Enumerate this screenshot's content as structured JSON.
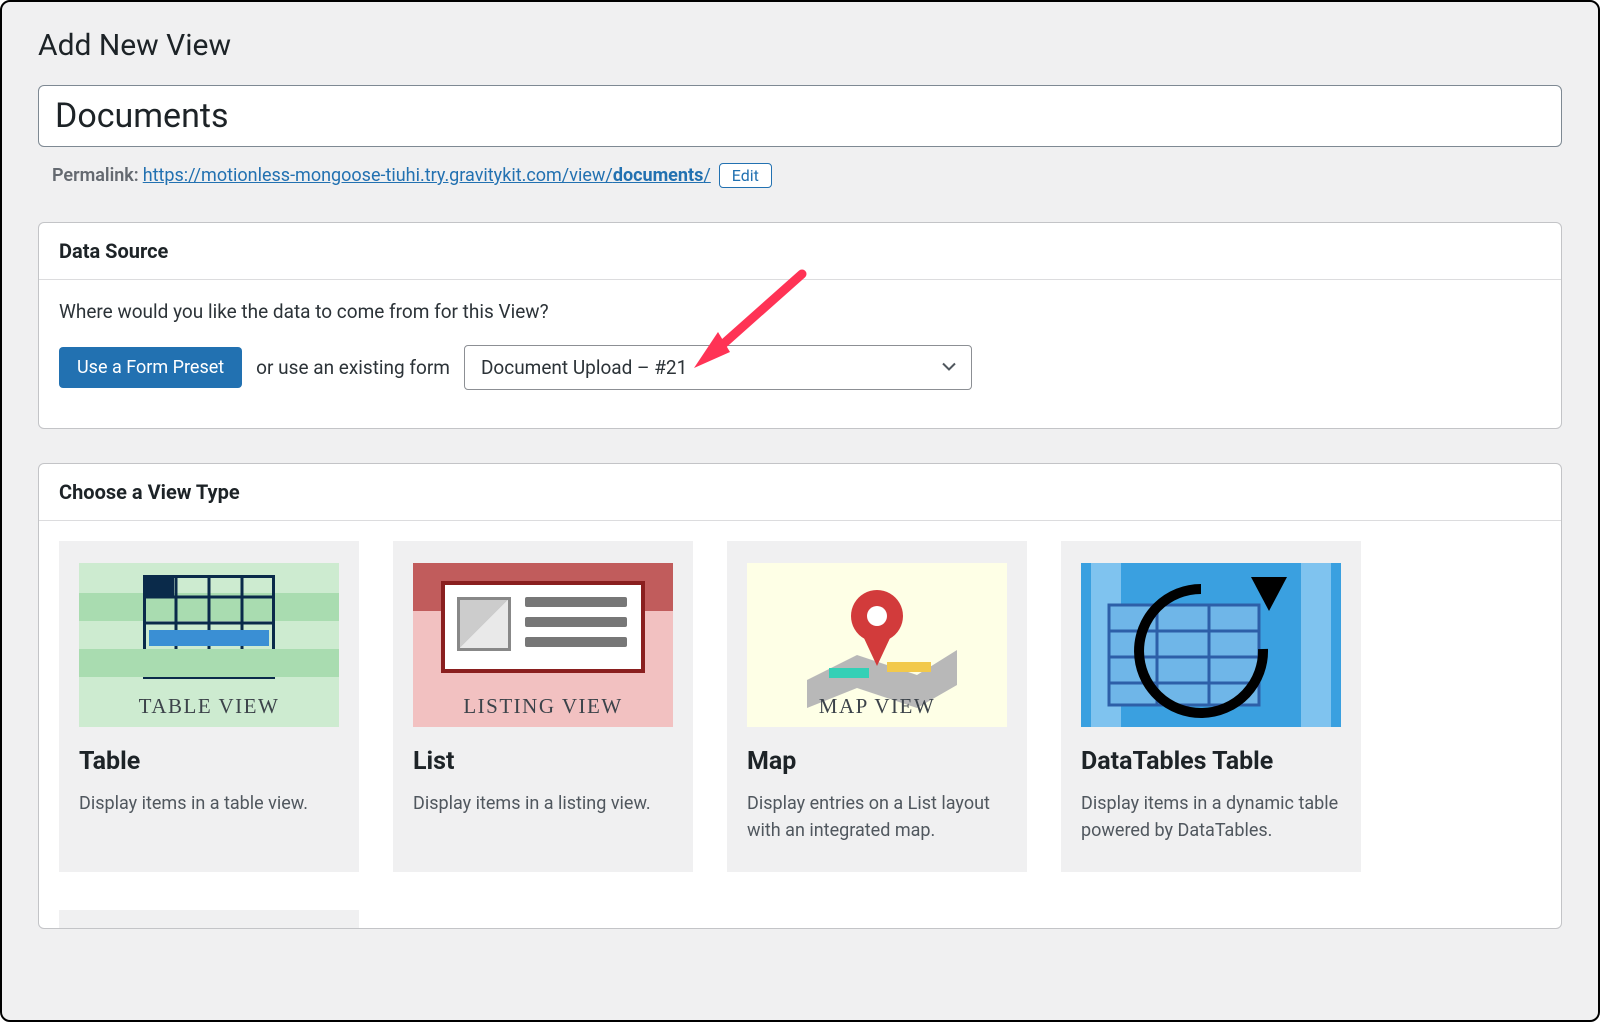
{
  "page": {
    "title": "Add New View"
  },
  "title_field": {
    "value": "Documents"
  },
  "permalink": {
    "label": "Permalink:",
    "url_base": "https://motionless-mongoose-tiuhi.try.gravitykit.com/view/",
    "url_slug": "documents",
    "url_trail": "/",
    "edit_label": "Edit"
  },
  "data_source": {
    "heading": "Data Source",
    "question": "Where would you like the data to come from for this View?",
    "preset_button": "Use a Form Preset",
    "or_text": "or use an existing form",
    "selected_form": "Document Upload – #21"
  },
  "view_type": {
    "heading": "Choose a View Type",
    "cards": [
      {
        "caption": "TABLE VIEW",
        "title": "Table",
        "desc": "Display items in a table view."
      },
      {
        "caption": "LISTING VIEW",
        "title": "List",
        "desc": "Display items in a listing view."
      },
      {
        "caption": "MAP VIEW",
        "title": "Map",
        "desc": "Display entries on a List layout with an integrated map."
      },
      {
        "caption": "",
        "title": "DataTables Table",
        "desc": "Display items in a dynamic table powered by DataTables."
      }
    ]
  }
}
